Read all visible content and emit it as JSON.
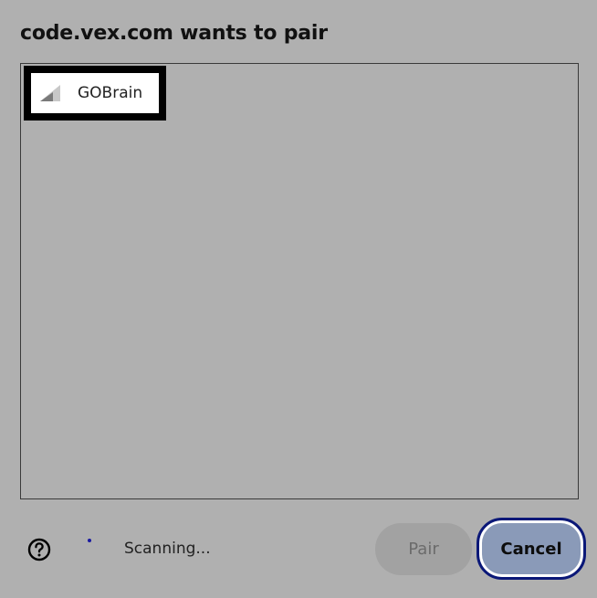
{
  "dialog": {
    "title": "code.vex.com wants to pair"
  },
  "device_list": {
    "items": [
      {
        "name": "GOBrain",
        "icon": "signal-strength-icon",
        "selected": true
      }
    ]
  },
  "footer": {
    "help_icon": "help-circle-icon",
    "status": "Scanning...",
    "pair_label": "Pair",
    "cancel_label": "Cancel"
  },
  "colors": {
    "background": "#b0b0b0",
    "selection_border": "#000000",
    "cancel_focus_ring": "#0b1878",
    "cancel_fill": "#8a9ab8",
    "pair_disabled_fill": "#a2a2a2",
    "spinner": "#1a1aa0"
  }
}
